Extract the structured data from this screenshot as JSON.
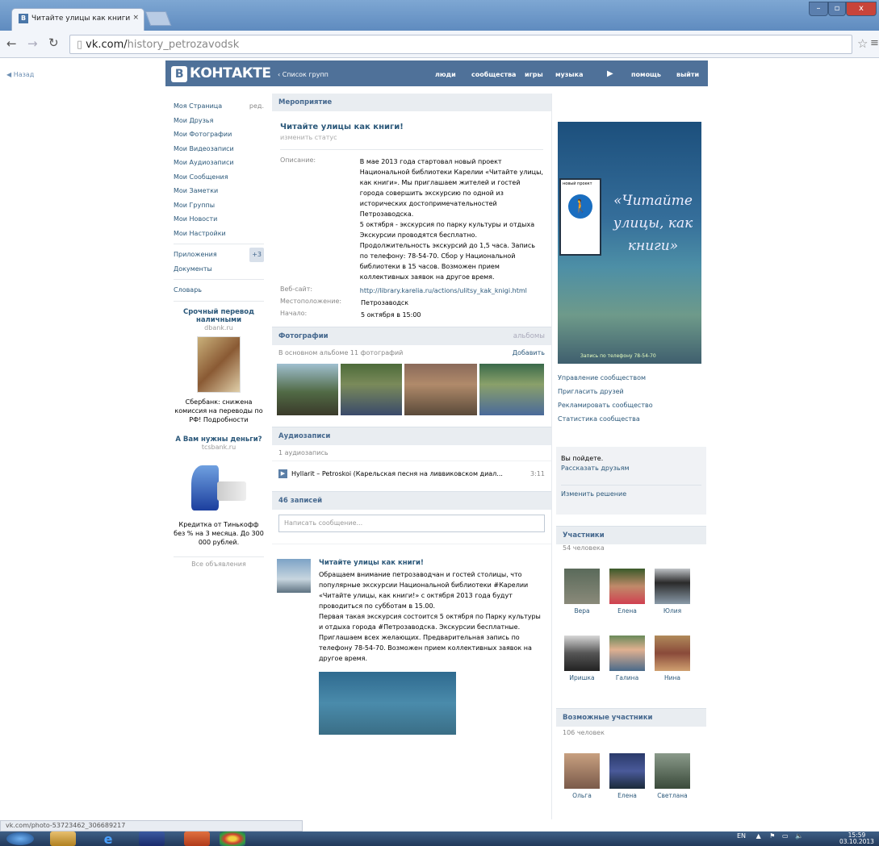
{
  "browser": {
    "tab_title": "Читайте улицы как книги",
    "url_host": "vk.com/",
    "url_path": "history_petrozavodsk"
  },
  "page": {
    "back_link": "Назад"
  },
  "vk": {
    "logo_text": "КОНТАКТЕ",
    "logo_letter": "В",
    "group_list_link": "‹ Список групп",
    "top_nav": [
      "люди",
      "сообщества",
      "игры",
      "музыка",
      "помощь",
      "выйти"
    ]
  },
  "left_menu": {
    "items": [
      "Моя Страница",
      "Мои Друзья",
      "Мои Фотографии",
      "Мои Видеозаписи",
      "Мои Аудиозаписи",
      "Мои Сообщения",
      "Мои Заметки",
      "Мои Группы",
      "Мои Новости",
      "Мои Настройки"
    ],
    "edit_label": "ред.",
    "apps_label": "Приложения",
    "apps_badge": "+3",
    "docs_label": "Документы",
    "dict_label": "Словарь",
    "ads": [
      {
        "title": "Срочный перевод наличными",
        "domain": "dbank.ru",
        "text": "Сбербанк: снижена комиссия на переводы по РФ! Подробности"
      },
      {
        "title": "А Вам нужны деньги?",
        "domain": "tcsbank.ru",
        "text": "Кредитка от Тинькофф без % на 3 месяца. До 300 000 рублей."
      }
    ],
    "all_ads": "Все объявления"
  },
  "main": {
    "section_title": "Мероприятие",
    "group_title": "Читайте улицы как книги!",
    "change_status": "изменить статус",
    "info": [
      {
        "label": "Описание:",
        "value": "В мае 2013 года стартовал новый проект Национальной библиотеки Карелии «Читайте улицы, как книги». Мы приглашаем жителей и гостей города совершить экскурсию по одной из исторических достопримечательностей Петрозаводска.\n5 октября - экскурсия по парку культуры и отдыха Экскурсии проводятся бесплатно. Продолжительность экскурсий до 1,5 часа. Запись по телефону: 78-54-70. Сбор у Национальной библиотеки в 15 часов. Возможен прием коллективных заявок на другое время."
      },
      {
        "label": "Веб-сайт:",
        "value": "http://library.karelia.ru/actions/ulitsy_kak_knigi.html"
      },
      {
        "label": "Местоположение:",
        "value": "Петрозаводск"
      },
      {
        "label": "Начало:",
        "value": "5 октября в 15:00"
      }
    ],
    "photos_title": "Фотографии",
    "photos_albums": "альбомы",
    "photos_subtitle": "В основном альбоме 11 фотографий",
    "photos_add": "Добавить",
    "audio_title": "Аудиозаписи",
    "audio_count": "1 аудиозапись",
    "audio_track": "Hyllаrit – Petroskoi (Карельская песня на ливвиковском диал...",
    "audio_duration": "3:11",
    "wall_title": "46 записей",
    "wall_placeholder": "Написать сообщение...",
    "post_title": "Читайте улицы как книги!",
    "post_text": "Обращаем внимание петрозаводчан и гостей столицы, что популярные экскурсии Национальной библиотеки #Карелии «Читайте улицы, как книги!» с октября 2013 года будут проводиться по субботам в 15.00.\nПервая такая экскурсия состоится 5 октября по Парку культуры и отдыха города #Петрозаводска. Экскурсии бесплатные. Приглашаем всех желающих. Предварительная запись по телефону 78-54-70. Возможен прием коллективных заявок на другое время."
  },
  "right": {
    "poster_headline": "«Читайте улицы, как книги»",
    "poster_sign": "новый проект",
    "poster_footer": "Запись по телефону 78-54-70",
    "manage_links": [
      "Управление сообществом",
      "Пригласить друзей",
      "Рекламировать сообщество",
      "Статистика сообщества"
    ],
    "going_label": "Вы пойдете.",
    "tell_friends": "Рассказать друзьям",
    "change_decision": "Изменить решение",
    "members_title": "Участники",
    "members_count": "54 человека",
    "members": [
      "Вера",
      "Елена",
      "Юлия",
      "Иришка",
      "Галина",
      "Нина"
    ],
    "possible_title": "Возможные участники",
    "possible_count": "106 человек",
    "possible": [
      "Ольга",
      "Елена",
      "Светлана"
    ]
  },
  "status_bar": {
    "url": "vk.com/photo-53723462_306689217"
  },
  "taskbar": {
    "lang": "EN",
    "time": "15:59",
    "date": "03.10.2013"
  }
}
